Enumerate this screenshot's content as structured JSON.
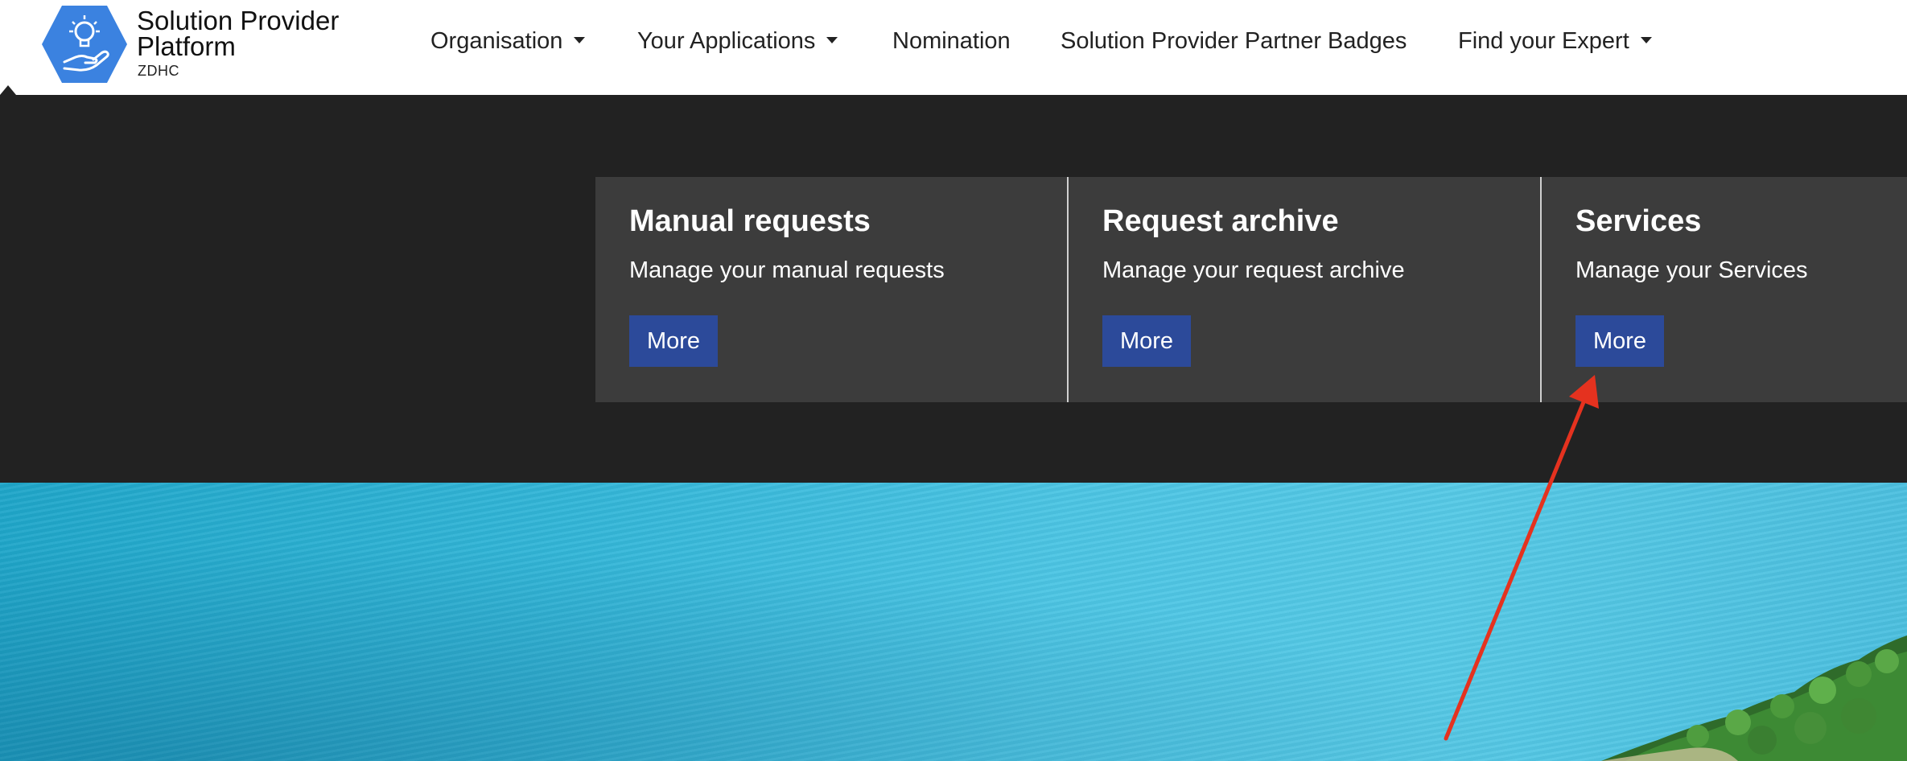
{
  "brand": {
    "title": "Solution Provider Platform",
    "subtitle": "ZDHC",
    "logo_icon": "lightbulb-hand-icon"
  },
  "nav": {
    "items": [
      {
        "label": "Organisation",
        "has_dropdown": true
      },
      {
        "label": "Your Applications",
        "has_dropdown": true
      },
      {
        "label": "Nomination",
        "has_dropdown": false
      },
      {
        "label": "Solution Provider Partner Badges",
        "has_dropdown": false
      },
      {
        "label": "Find your Expert",
        "has_dropdown": true
      }
    ]
  },
  "cards": [
    {
      "title": "Manual requests",
      "description": "Manage your manual requests",
      "button_label": "More"
    },
    {
      "title": "Request archive",
      "description": "Manage your request archive",
      "button_label": "More"
    },
    {
      "title": "Services",
      "description": "Manage your Services",
      "button_label": "More"
    }
  ],
  "colors": {
    "logo_blue": "#3b82e0",
    "dark_band": "#222222",
    "card_bg": "#3c3c3c",
    "button_blue": "#2c4a9a",
    "annotation_red": "#e5321f",
    "lagoon": "#4cc5e4"
  }
}
